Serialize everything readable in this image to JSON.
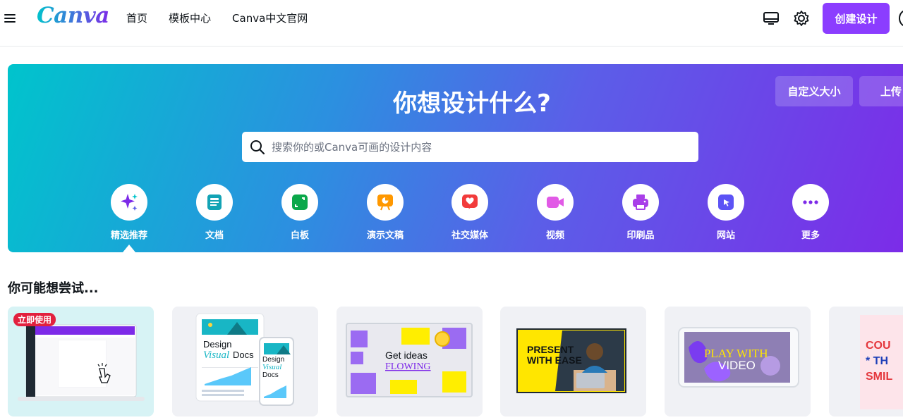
{
  "header": {
    "logo": "Canva",
    "nav": [
      "首页",
      "模板中心",
      "Canva中文官网"
    ],
    "create_button": "创建设计",
    "icons": [
      "menu-icon",
      "desktop-app-icon",
      "gear-icon"
    ]
  },
  "hero": {
    "title": "你想设计什么?",
    "custom_size_button": "自定义大小",
    "upload_button": "上传",
    "search_placeholder": "搜索你的或Canva可画的设计内容",
    "categories": [
      {
        "label": "精选推荐",
        "icon": "sparkle-icon",
        "color": "#7d2ae8"
      },
      {
        "label": "文档",
        "icon": "document-icon",
        "color": "#13a3b5"
      },
      {
        "label": "白板",
        "icon": "whiteboard-icon",
        "color": "#0ba84a"
      },
      {
        "label": "演示文稿",
        "icon": "presentation-icon",
        "color": "#ff9800"
      },
      {
        "label": "社交媒体",
        "icon": "heart-icon",
        "color": "#f23b3b"
      },
      {
        "label": "视频",
        "icon": "video-icon",
        "color": "#e15ae6"
      },
      {
        "label": "印刷品",
        "icon": "printer-icon",
        "color": "#a93ee9"
      },
      {
        "label": "网站",
        "icon": "website-cursor-icon",
        "color": "#5c53f5"
      },
      {
        "label": "更多",
        "icon": "more-icon",
        "color": "#7d2ae8"
      }
    ]
  },
  "suggestions": {
    "title": "你可能想尝试...",
    "badge": "立即使用",
    "doc_card": {
      "line1": "Design",
      "line2": "Visual",
      "line3": "Docs"
    },
    "whiteboard_card": {
      "line1": "Get ideas",
      "line2": "FLOWING"
    },
    "presentation_card": {
      "line1": "PRESENT",
      "line2": "WITH EASE"
    },
    "video_card": {
      "line1": "PLAY WITH",
      "line2": "VIDEO"
    },
    "poster_card": {
      "text1": "COU",
      "text2": "* TH",
      "text3": "SMIL"
    }
  },
  "colors": {
    "accent": "#8b3dff",
    "hero_start": "#00c4cc",
    "hero_end": "#7d2ae8"
  }
}
